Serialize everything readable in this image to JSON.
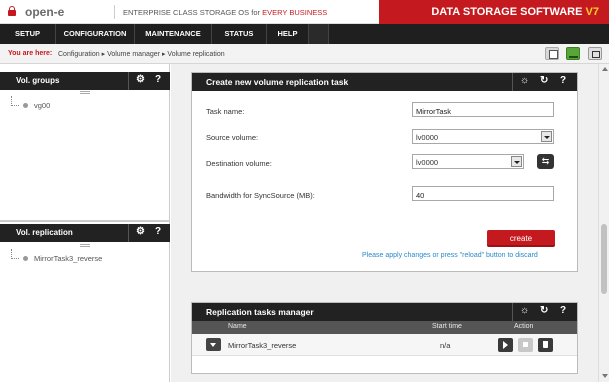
{
  "header": {
    "brand": "open-e",
    "tagline_prefix": "ENTERPRISE CLASS STORAGE OS for ",
    "tagline_emph": "EVERY BUSINESS",
    "product": "DATA STORAGE SOFTWARE ",
    "version": "V7"
  },
  "menu": {
    "items": [
      {
        "label": "SETUP"
      },
      {
        "label": "CONFIGURATION"
      },
      {
        "label": "MAINTENANCE"
      },
      {
        "label": "STATUS"
      },
      {
        "label": "HELP"
      }
    ]
  },
  "breadcrumb": {
    "prefix": "You are here:",
    "items": [
      "Configuration",
      "Volume manager",
      "Volume replication"
    ]
  },
  "left": {
    "vol_groups": {
      "title": "Vol. groups",
      "items": [
        "vg00"
      ]
    },
    "vol_replication": {
      "title": "Vol. replication",
      "items": [
        "MirrorTask3_reverse"
      ]
    },
    "gear_icon": "gear-icon",
    "help_icon": "?"
  },
  "create_task": {
    "title": "Create new volume replication task",
    "task_name_label": "Task name:",
    "task_name_value": "MirrorTask",
    "source_label": "Source volume:",
    "source_value": "lv0000",
    "dest_label": "Destination volume:",
    "dest_value": "lv0000",
    "bandwidth_label": "Bandwidth for SyncSource (MB):",
    "bandwidth_value": "40",
    "create_label": "create",
    "note": "Please apply changes or press \"reload\" button to discard"
  },
  "tasks_manager": {
    "title": "Replication tasks manager",
    "columns": {
      "name": "Name",
      "start_time": "Start time",
      "action": "Action"
    },
    "rows": [
      {
        "name": "MirrorTask3_reverse",
        "start_time": "n/a"
      }
    ]
  },
  "colors": {
    "brand_red": "#c41a1f",
    "header_dark": "#222222",
    "link_blue": "#2a8ac9"
  }
}
